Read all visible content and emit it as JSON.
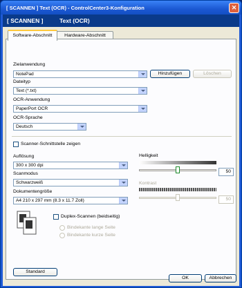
{
  "window": {
    "title": "[ SCANNEN ]  Text (OCR) - ControlCenter3-Konfiguration",
    "close_glyph": "✕"
  },
  "header": {
    "section": "[ SCANNEN ]",
    "name": "Text (OCR)"
  },
  "tabs": [
    {
      "label": "Software-Abschnitt",
      "active": true
    },
    {
      "label": "Hardware-Abschnitt",
      "active": false
    }
  ],
  "target_app": {
    "label": "Zielanwendung",
    "value": "NotePad",
    "add_button": "Hinzufügen",
    "delete_button": "Löschen"
  },
  "file_type": {
    "label": "Dateityp",
    "value": "Text (*.txt)"
  },
  "ocr_app": {
    "label": "OCR-Anwendung",
    "value": "PaperPort OCR"
  },
  "ocr_language": {
    "label": "OCR-Sprache",
    "value": "Deutsch"
  },
  "scanner_interface": {
    "label": "Scanner-Schnittstelle zeigen",
    "checked": false
  },
  "resolution": {
    "label": "Auflösung",
    "value": "300 x 300 dpi"
  },
  "scan_mode": {
    "label": "Scanmodus",
    "value": "Schwarzweiß"
  },
  "document_size": {
    "label": "Dokumentengröße",
    "value": "A4 210 x 297 mm (8.3 x 11.7 Zoll)"
  },
  "brightness": {
    "label": "Helligkeit",
    "value": "50",
    "level": 0.5
  },
  "contrast": {
    "label": "Kontrast",
    "value": "50",
    "level": 0.5,
    "enabled": false
  },
  "duplex": {
    "label": "Duplex-Scannen (beidseitig)",
    "checked": false,
    "options": [
      "Bindekante lange Seite",
      "Bindekante kurze Seite"
    ]
  },
  "buttons": {
    "standard": "Standard",
    "ok": "OK",
    "cancel": "Abbrechen"
  },
  "colors": {
    "accent_green": "#1c8a2a",
    "title_blue": "#1b58d2",
    "header_navy": "#0a3a8a"
  }
}
